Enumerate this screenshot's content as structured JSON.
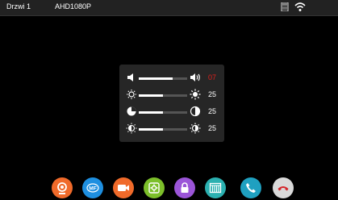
{
  "status_bar": {
    "door_label": "Drzwi 1",
    "resolution": "AHD1080P",
    "icons": [
      "sd-card-icon",
      "wifi-icon"
    ]
  },
  "panel": {
    "rows": [
      {
        "name": "volume",
        "value": "07",
        "level": 0.7,
        "value_color": "#e0201c",
        "icon_left": "speaker-low-icon",
        "icon_right": "speaker-high-icon"
      },
      {
        "name": "brightness",
        "value": "25",
        "level": 0.5,
        "value_color": "#ffffff",
        "icon_left": "sun-low-icon",
        "icon_right": "sun-high-icon"
      },
      {
        "name": "contrast",
        "value": "25",
        "level": 0.5,
        "value_color": "#ffffff",
        "icon_left": "contrast-low-icon",
        "icon_right": "contrast-high-icon"
      },
      {
        "name": "color",
        "value": "25",
        "level": 0.5,
        "value_color": "#ffffff",
        "icon_left": "color-low-icon",
        "icon_right": "color-high-icon"
      }
    ]
  },
  "dock": {
    "buttons": [
      {
        "name": "camera-button",
        "icon": "camera-icon",
        "color": "#f06a2a"
      },
      {
        "name": "mf-button",
        "icon": "mf-icon",
        "color": "#1e8fe0",
        "label": "MF"
      },
      {
        "name": "video-record-button",
        "icon": "video-camera-icon",
        "color": "#f06a2a"
      },
      {
        "name": "settings-button",
        "icon": "gear-icon",
        "color": "#7cbf2a"
      },
      {
        "name": "unlock-button",
        "icon": "lock-icon",
        "color": "#9b55d8"
      },
      {
        "name": "gate-button",
        "icon": "gate-icon",
        "color": "#2bb0b0"
      },
      {
        "name": "answer-call-button",
        "icon": "phone-icon",
        "color": "#1fa0c0"
      },
      {
        "name": "hang-up-button",
        "icon": "phone-hangup-icon",
        "color": "#d9d9d9"
      }
    ]
  }
}
